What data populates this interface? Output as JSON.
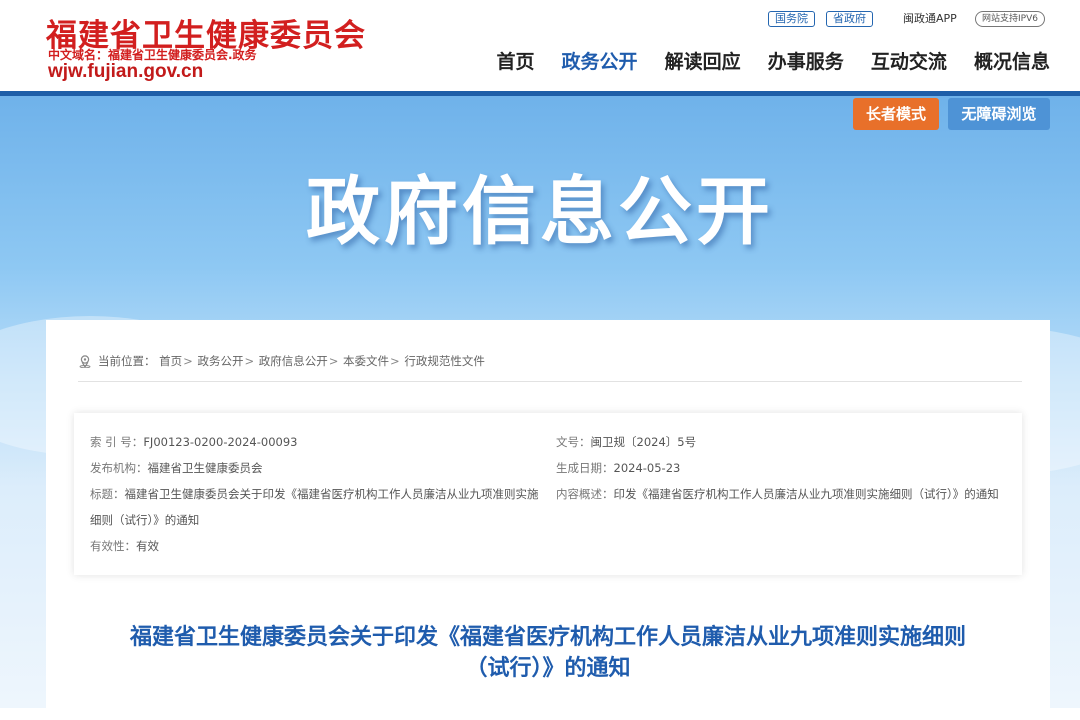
{
  "header": {
    "logo_cn": "福建省卫生健康委员会",
    "logo_domain": "中文域名：福建省卫生健康委员会.政务",
    "logo_url": "wjw.fujian.gov.cn",
    "top_links": {
      "state_council": "国务院",
      "province_gov": "省政府",
      "app": "闽政通APP",
      "ipv6": "网站支持IPV6"
    },
    "nav": [
      "首页",
      "政务公开",
      "解读回应",
      "办事服务",
      "互动交流",
      "概况信息"
    ],
    "nav_active_index": 1
  },
  "banner": {
    "title": "政府信息公开",
    "elder_mode": "长者模式",
    "accessible": "无障碍浏览"
  },
  "breadcrumb": {
    "prefix": "当前位置：",
    "items": [
      "首页",
      "政务公开",
      "政府信息公开",
      "本委文件",
      "行政规范性文件"
    ],
    "separator": ">"
  },
  "meta": {
    "index_no": {
      "label": "索 引 号：",
      "value": "FJ00123-0200-2024-00093"
    },
    "doc_no": {
      "label": "文号：",
      "value": "闽卫规〔2024〕5号"
    },
    "publisher": {
      "label": "发布机构：",
      "value": "福建省卫生健康委员会"
    },
    "date": {
      "label": "生成日期：",
      "value": "2024-05-23"
    },
    "title": {
      "label": "标题：",
      "value": "福建省卫生健康委员会关于印发《福建省医疗机构工作人员廉洁从业九项准则实施细则（试行）》的通知"
    },
    "summary": {
      "label": "内容概述：",
      "value": "印发《福建省医疗机构工作人员廉洁从业九项准则实施细则（试行）》的通知"
    },
    "validity": {
      "label": "有效性：",
      "value": "有效"
    }
  },
  "document": {
    "title_line1": "福建省卫生健康委员会关于印发《福建省医疗机构工作人员廉洁从业九项准则实施细则",
    "title_line2": "（试行）》的通知"
  },
  "colors": {
    "brand_red": "#d21f1f",
    "brand_blue": "#1f5cad",
    "elder_orange": "#e8702a",
    "access_blue": "#4e93d6"
  }
}
